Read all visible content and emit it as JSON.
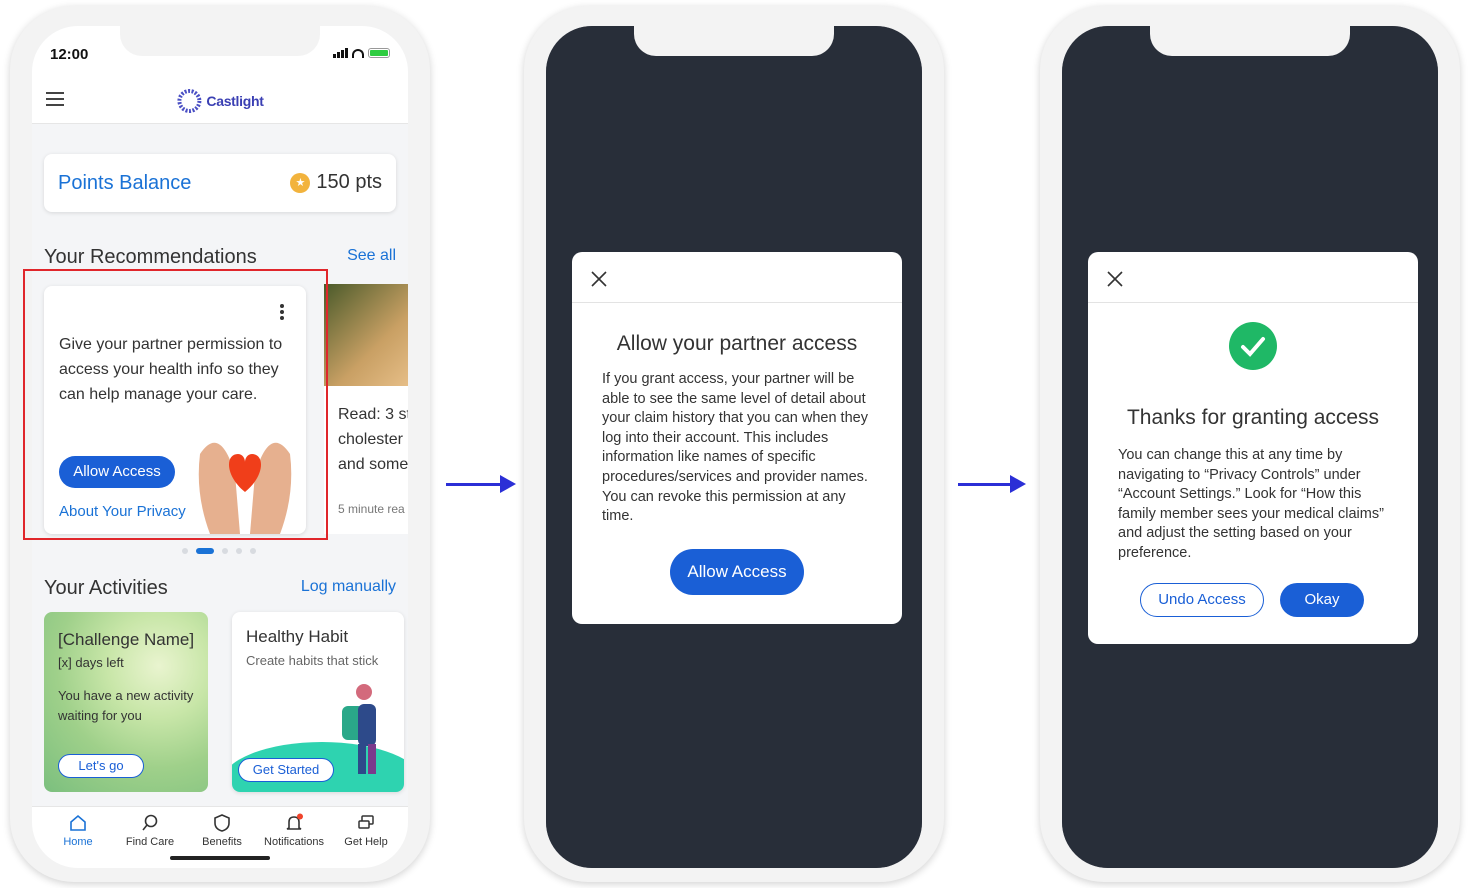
{
  "status": {
    "time": "12:00"
  },
  "app": {
    "brand": "Castlight"
  },
  "points": {
    "label": "Points Balance",
    "value": "150 pts"
  },
  "recommendations": {
    "title": "Your Recommendations",
    "see_all": "See all",
    "card": {
      "text": "Give your partner permission to access your health info so they can help manage your care.",
      "button": "Allow Access",
      "link": "About Your Privacy"
    },
    "card2": {
      "text_lines": [
        "Read: 3 st",
        "cholester",
        "and somet"
      ],
      "meta": "5 minute rea"
    }
  },
  "activities": {
    "title": "Your Activities",
    "link": "Log manually",
    "challenge": {
      "title": "[Challenge Name]",
      "days": "[x] days left",
      "desc": "You have a new activity waiting for you",
      "button": "Let's go"
    },
    "habit": {
      "title": "Healthy Habit",
      "desc": "Create habits that stick",
      "button": "Get Started"
    }
  },
  "tabs": [
    {
      "label": "Home",
      "icon": "home-icon"
    },
    {
      "label": "Find Care",
      "icon": "search-icon"
    },
    {
      "label": "Benefits",
      "icon": "shield-icon"
    },
    {
      "label": "Notifications",
      "icon": "bell-icon"
    },
    {
      "label": "Get Help",
      "icon": "chat-icon"
    }
  ],
  "modal_allow": {
    "title": "Allow your partner access",
    "body": "If you grant access, your partner will be able to see the same level of detail about your claim history that you can when they log into their account. This includes information like names of specific procedures/services and provider names. You can revoke this permission at any time.",
    "button": "Allow Access"
  },
  "modal_thanks": {
    "title": "Thanks for granting access",
    "body": "You can change this at any time by navigating to “Privacy Controls” under “Account Settings.” Look for “How this family member sees your medical claims” and adjust the setting based on your preference.",
    "undo": "Undo Access",
    "okay": "Okay"
  },
  "colors": {
    "accent": "#1a5fd6",
    "link": "#1a72d6",
    "highlight": "#e0262b",
    "arrow": "#2b2fd6",
    "success": "#1fb866"
  }
}
